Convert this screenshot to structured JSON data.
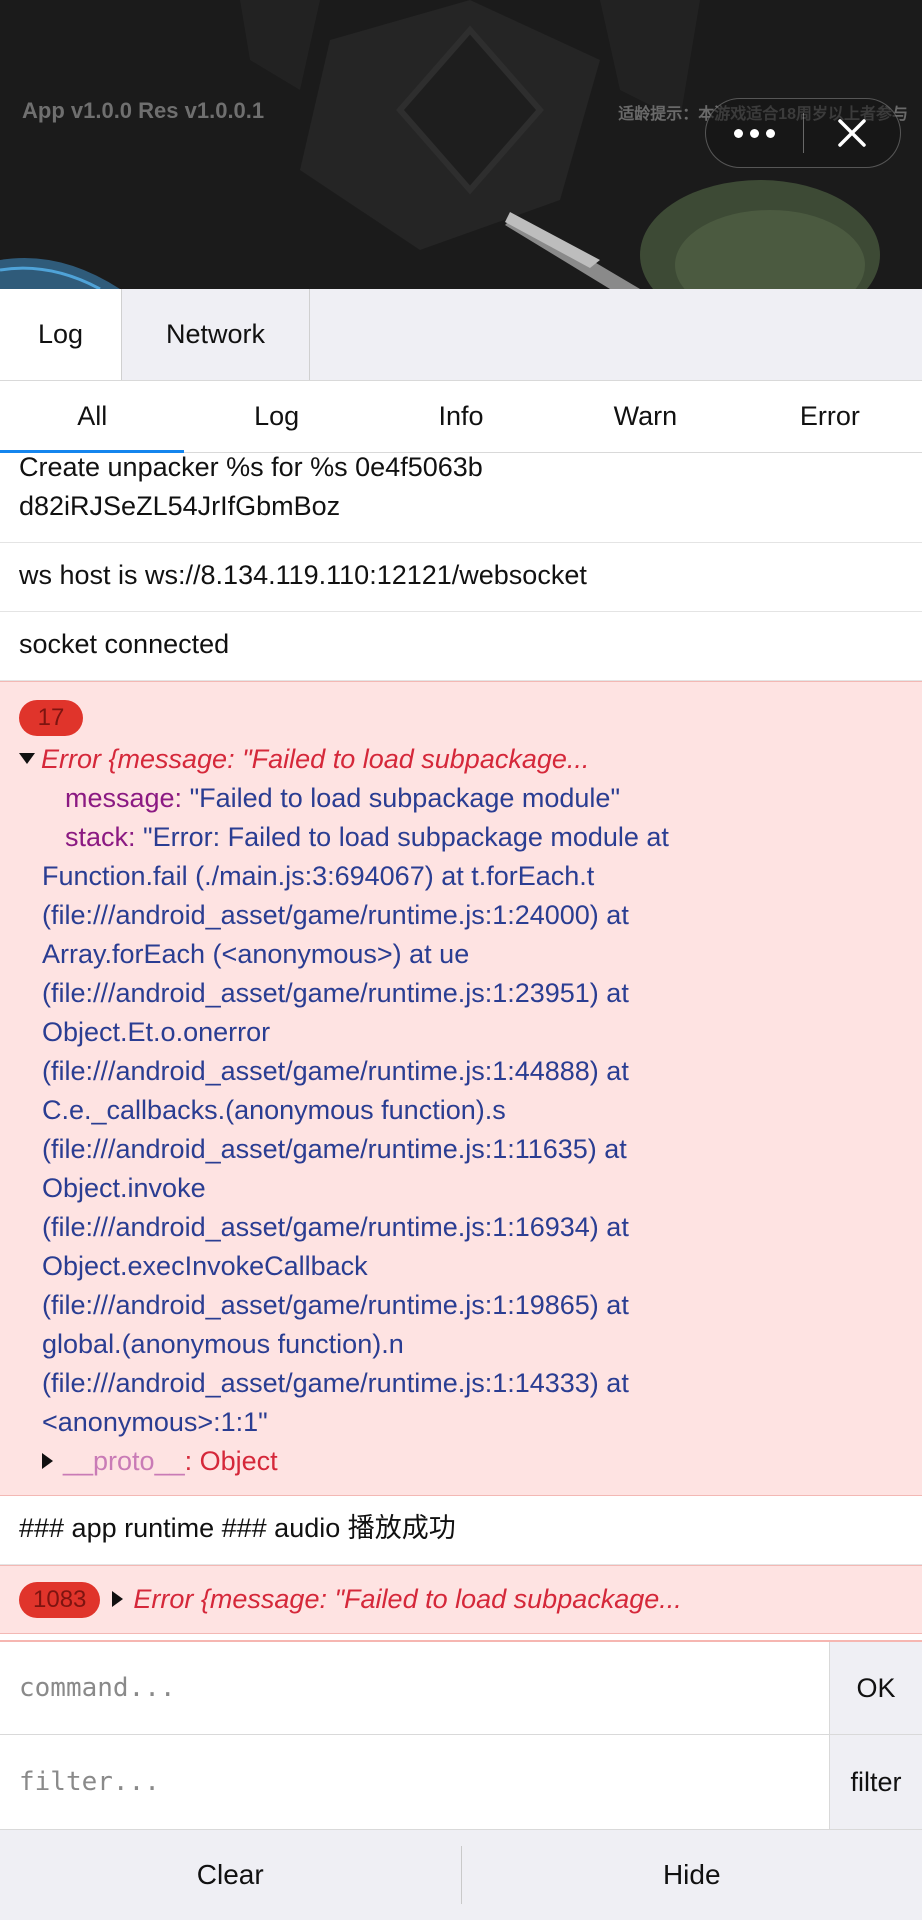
{
  "game": {
    "version_text": "App v1.0.0  Res v1.0.0.1",
    "age_tip": "适龄提示：本游戏适合18周岁以上者参与"
  },
  "top_tabs": [
    {
      "label": "Log",
      "active": true
    },
    {
      "label": "Network",
      "active": false
    }
  ],
  "filter_tabs": [
    {
      "label": "All",
      "active": true
    },
    {
      "label": "Log",
      "active": false
    },
    {
      "label": "Info",
      "active": false
    },
    {
      "label": "Warn",
      "active": false
    },
    {
      "label": "Error",
      "active": false
    }
  ],
  "logs": {
    "unpacker_line1": "Create unpacker %s for %s 0e4f5063b",
    "unpacker_line2": "d82iRJSeZL54JrIfGbmBoz",
    "ws_host": "ws host is ws://8.134.119.110:12121/websocket",
    "socket": "socket connected",
    "error_expanded": {
      "count": "17",
      "head": "Error {message: \"Failed to load subpackage...",
      "message_key": "message:",
      "message_value": "\"Failed to load subpackage module\"",
      "stack_key": "stack:",
      "stack_first": "\"Error: Failed to load subpackage module at",
      "stack_lines": [
        "Function.fail (./main.js:3:694067) at t.forEach.t",
        "(file:///android_asset/game/runtime.js:1:24000) at",
        "Array.forEach (<anonymous>) at ue",
        "(file:///android_asset/game/runtime.js:1:23951) at",
        "Object.Et.o.onerror",
        "(file:///android_asset/game/runtime.js:1:44888) at",
        "C.e._callbacks.(anonymous function).s",
        "(file:///android_asset/game/runtime.js:1:11635) at",
        "Object.invoke",
        "(file:///android_asset/game/runtime.js:1:16934) at",
        "Object.execInvokeCallback",
        "(file:///android_asset/game/runtime.js:1:19865) at",
        "global.(anonymous function).n",
        "(file:///android_asset/game/runtime.js:1:14333) at",
        "<anonymous>:1:1\""
      ],
      "proto_key": "__proto__",
      "proto_value": ": Object"
    },
    "audio": "### app runtime ### audio 播放成功",
    "error_collapsed": {
      "count": "1083",
      "head": "Error {message: \"Failed to load subpackage..."
    }
  },
  "command": {
    "placeholder": "command...",
    "ok_label": "OK"
  },
  "filter": {
    "placeholder": "filter...",
    "button_label": "filter"
  },
  "bottom": {
    "clear_label": "Clear",
    "hide_label": "Hide"
  }
}
